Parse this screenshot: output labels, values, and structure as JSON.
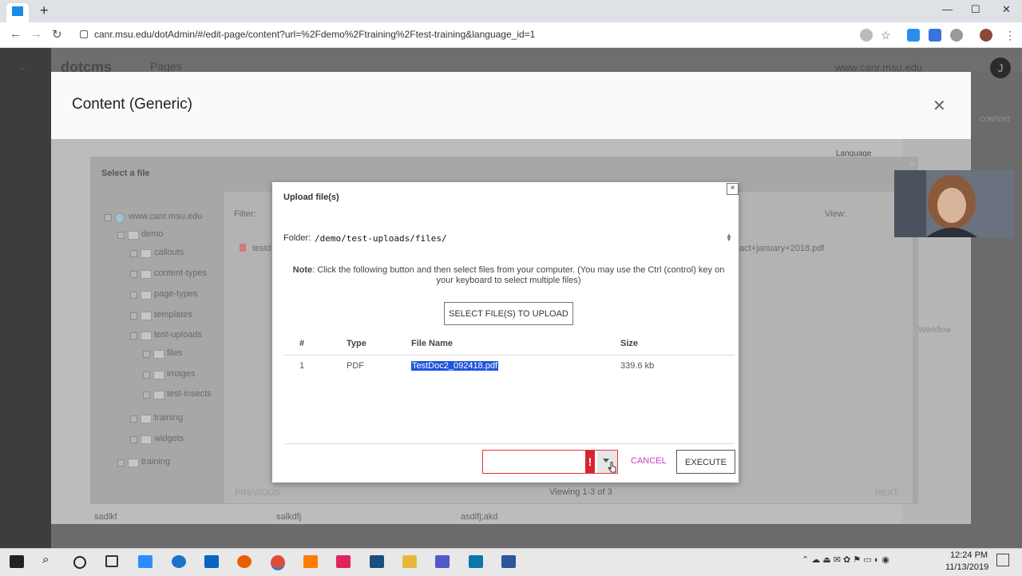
{
  "browser": {
    "url": "canr.msu.edu/dotAdmin/#/edit-page/content?url=%2Fdemo%2Ftraining%2Ftest-training&language_id=1",
    "new_tab": "+",
    "back": "←",
    "forward": "→",
    "reload": "↻",
    "minimize": "—",
    "maximize": "☐",
    "close": "✕"
  },
  "background_app": {
    "logo": "dotcms",
    "section": "Pages",
    "site": "www.canr.msu.edu",
    "avatar": "J",
    "right_label": "CONTENT",
    "language_label": "Language",
    "workflow_label": "Workflow",
    "list_file_left": "testd",
    "list_file_right": "act+january+2018.pdf",
    "view_label": "View:",
    "filter_label": "Filter:",
    "previous": "PREVIOUS",
    "next": "NEXT",
    "bottom_items": [
      "sadlkf",
      "salkdfj",
      "asdlfj;akd"
    ]
  },
  "content_modal": {
    "title": "Content (Generic)",
    "close": "✕"
  },
  "select_file": {
    "title": "Select a file",
    "tree": [
      {
        "label": "www.canr.msu.edu",
        "level": 0
      },
      {
        "label": "demo",
        "level": 1
      },
      {
        "label": "callouts",
        "level": 2
      },
      {
        "label": "content-types",
        "level": 2
      },
      {
        "label": "page-types",
        "level": 2
      },
      {
        "label": "templates",
        "level": 2
      },
      {
        "label": "test-uploads",
        "level": 2
      },
      {
        "label": "files",
        "level": 3
      },
      {
        "label": "images",
        "level": 3
      },
      {
        "label": "test-insects",
        "level": 3
      },
      {
        "label": "training",
        "level": 2
      },
      {
        "label": "widgets",
        "level": 2
      },
      {
        "label": "training",
        "level": 1
      }
    ],
    "viewing": "Viewing 1-3 of 3"
  },
  "upload": {
    "title": "Upload file(s)",
    "close": "×",
    "folder_label": "Folder:",
    "folder_path": "/demo/test-uploads/files/",
    "note_label": "Note",
    "note_text": ": Click the following button and then select files from your computer. (You may use the Ctrl (control) key on your keyboard to select multiple files)",
    "select_button": "SELECT FILE(S) TO UPLOAD",
    "columns": [
      "#",
      "Type",
      "File Name",
      "Size"
    ],
    "rows": [
      {
        "num": "1",
        "type": "PDF",
        "name": "TestDoc2_092418.pdf",
        "size": "339.6 kb"
      }
    ],
    "action_value": "",
    "error_mark": "!",
    "cancel": "CANCEL",
    "execute": "EXECUTE"
  },
  "taskbar": {
    "time": "12:24 PM",
    "date": "11/13/2019"
  },
  "colors": {
    "accent_link": "#c040c0",
    "error": "#d9232d",
    "selection": "#2255dd"
  }
}
